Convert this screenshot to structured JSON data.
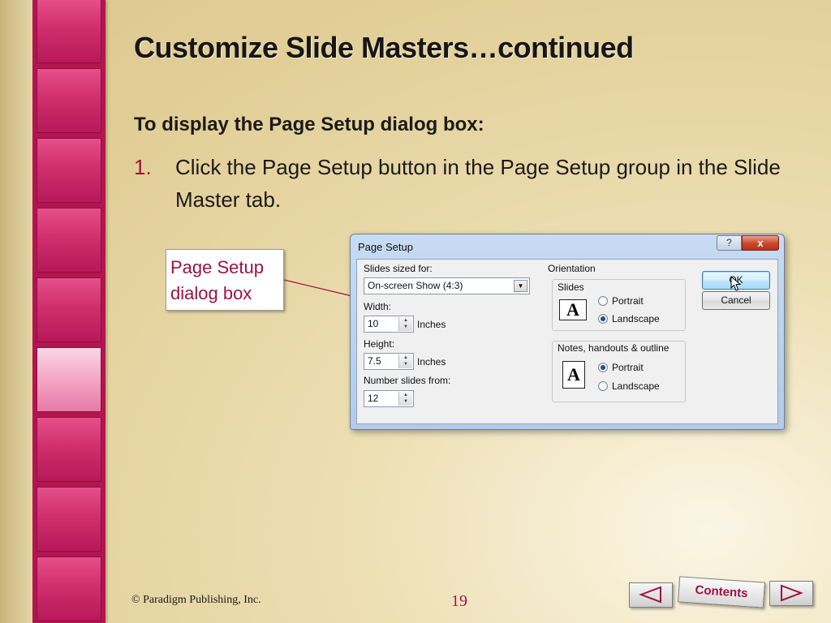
{
  "slide": {
    "title": "Customize Slide Masters…continued",
    "subhead": "To display the Page Setup dialog box:",
    "step_number": "1.",
    "step_text": "Click the Page Setup button in the Page Setup group in the Slide Master tab.",
    "callout": "Page Setup dialog box"
  },
  "dialog": {
    "title": "Page Setup",
    "help_label": "?",
    "close_label": "x",
    "slides_sized_for_label": "Slides sized for:",
    "slides_sized_for_value": "On-screen Show (4:3)",
    "width_label": "Width:",
    "width_value": "10",
    "width_unit": "Inches",
    "height_label": "Height:",
    "height_value": "7.5",
    "height_unit": "Inches",
    "number_from_label": "Number slides from:",
    "number_from_value": "12",
    "orientation_label": "Orientation",
    "slides_group_label": "Slides",
    "slides_portrait": "Portrait",
    "slides_landscape": "Landscape",
    "notes_group_label": "Notes, handouts & outline",
    "notes_portrait": "Portrait",
    "notes_landscape": "Landscape",
    "page_letter": "A",
    "ok_label": "OK",
    "cancel_label": "Cancel"
  },
  "footer": {
    "copyright": "© Paradigm Publishing, Inc.",
    "page_number": "19",
    "contents_label": "Contents"
  },
  "colors": {
    "accent": "#a01043",
    "strip": "#b3154f",
    "background": "#e2cf98"
  }
}
